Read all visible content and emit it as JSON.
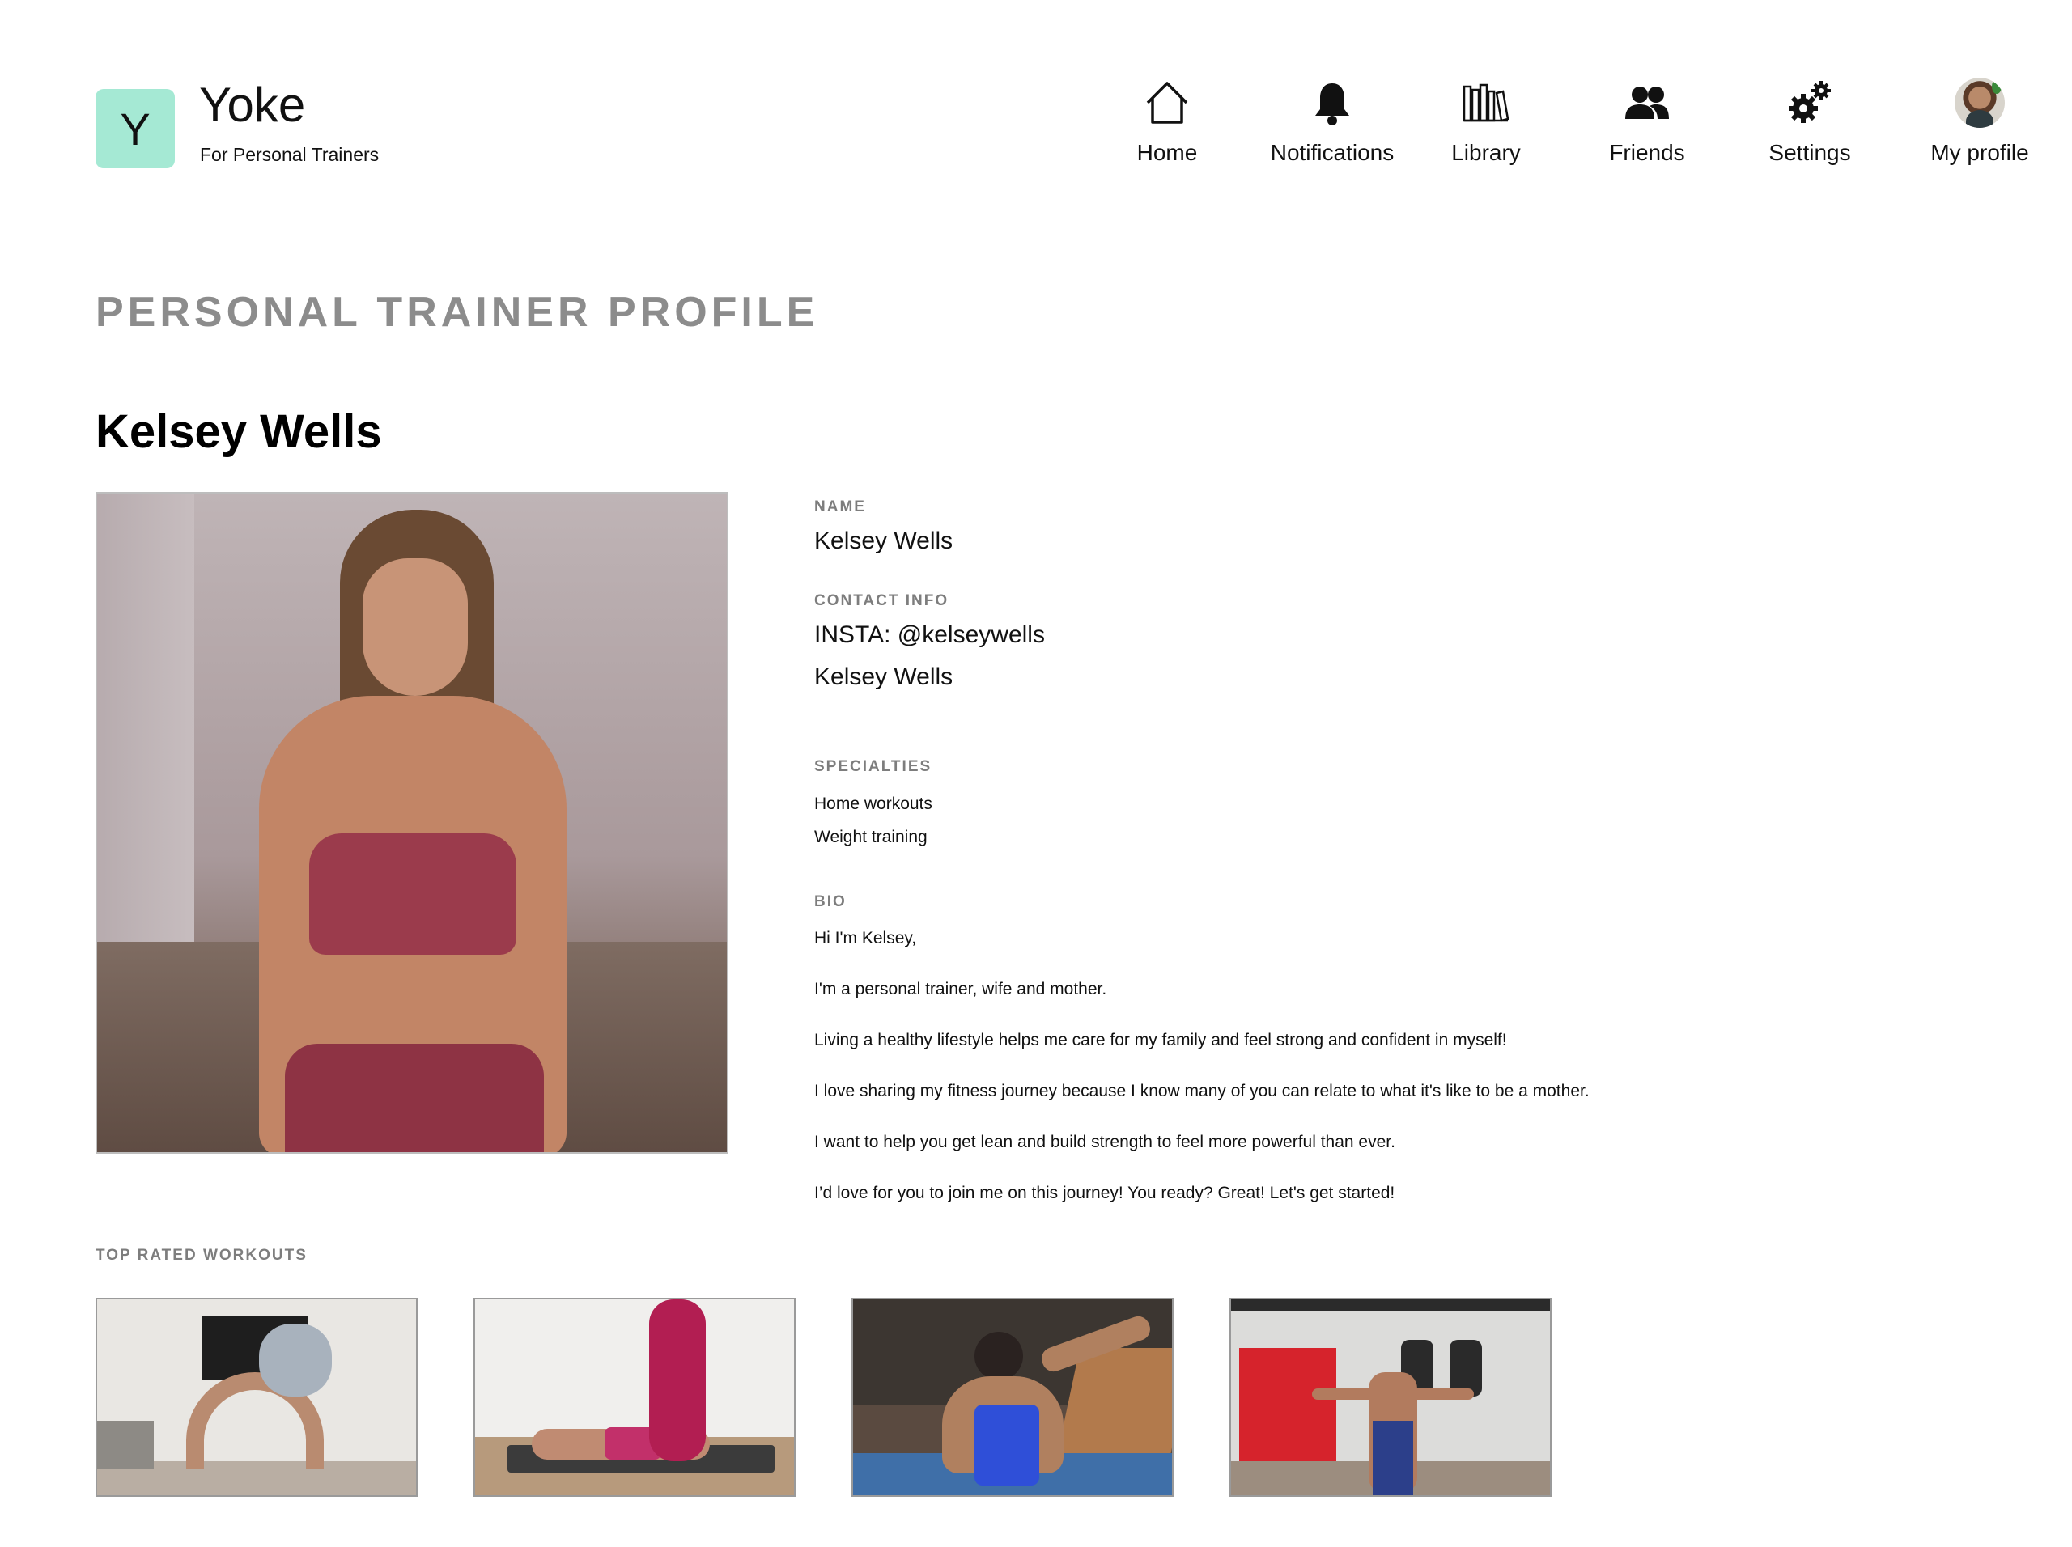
{
  "header": {
    "logo_letter": "Y",
    "brand_title": "Yoke",
    "brand_subtitle": "For Personal Trainers",
    "nav": [
      {
        "label": "Home",
        "icon": "home-icon"
      },
      {
        "label": "Notifications",
        "icon": "bell-icon"
      },
      {
        "label": "Library",
        "icon": "library-icon"
      },
      {
        "label": "Friends",
        "icon": "friends-icon"
      },
      {
        "label": "Settings",
        "icon": "gears-icon"
      },
      {
        "label": "My profile",
        "icon": "avatar"
      }
    ]
  },
  "page": {
    "heading": "PERSONAL TRAINER PROFILE",
    "trainer_name": "Kelsey Wells"
  },
  "profile": {
    "name_label": "NAME",
    "name_value": "Kelsey Wells",
    "contact_label": "CONTACT INFO",
    "contact_lines": [
      "INSTA: @kelseywells",
      "Kelsey Wells"
    ],
    "specialties_label": "SPECIALTIES",
    "specialties": [
      "Home workouts",
      "Weight training"
    ],
    "bio_label": "BIO",
    "bio_lines": [
      "Hi I'm Kelsey,",
      "I'm a personal trainer, wife and mother.",
      "Living a healthy lifestyle helps me care for my family and feel strong and confident in myself!",
      "I love sharing my fitness journey because I know many of you can relate to what it's like to be a mother.",
      "I want to help you get lean and build strength to feel more powerful than ever.",
      "I’d love for you to join me on this journey! You ready? Great! Let's get started!"
    ]
  },
  "workouts": {
    "label": "TOP RATED WORKOUTS",
    "count_shown": 4
  },
  "colors": {
    "logo_bg": "#a5e9d4",
    "heading_gray": "#8c8c8c",
    "label_gray": "#7d7d7d"
  }
}
